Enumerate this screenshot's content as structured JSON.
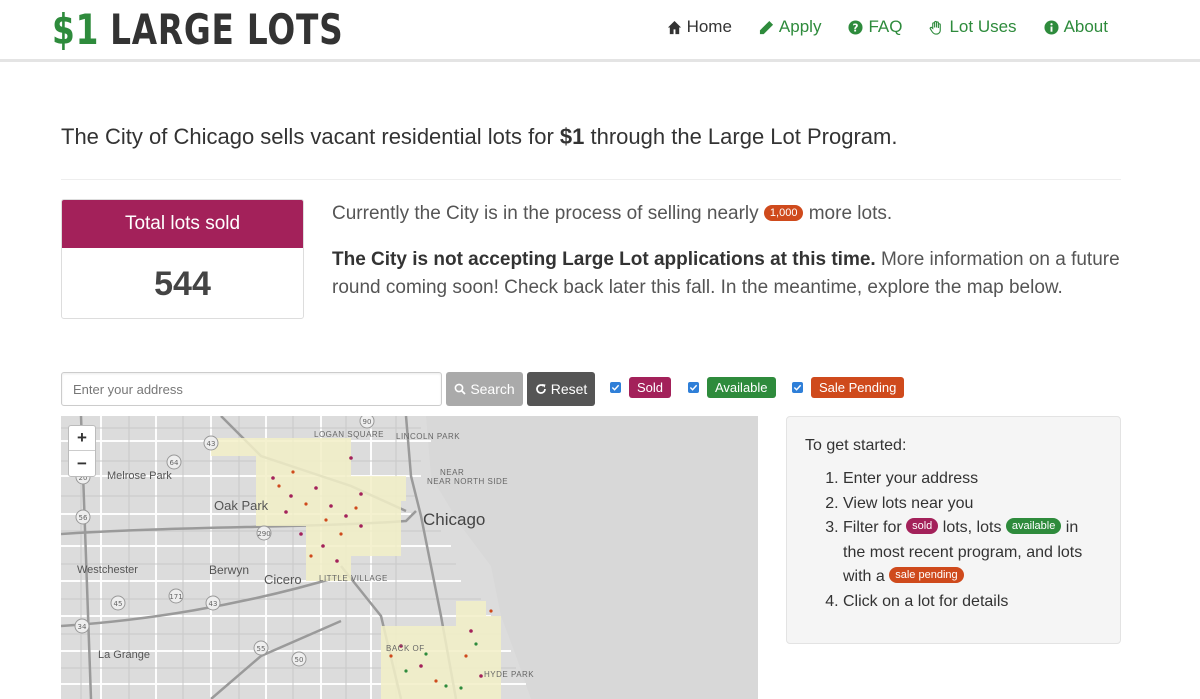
{
  "brand": {
    "dollar": "$1",
    "name": "LARGE LOTS"
  },
  "nav": [
    {
      "label": "Home",
      "icon": "home-icon"
    },
    {
      "label": "Apply",
      "icon": "pencil-icon"
    },
    {
      "label": "FAQ",
      "icon": "question-circle-icon"
    },
    {
      "label": "Lot Uses",
      "icon": "hand-icon"
    },
    {
      "label": "About",
      "icon": "info-circle-icon"
    }
  ],
  "intro": {
    "before": "The City of Chicago sells vacant residential lots for ",
    "bold": "$1",
    "after": " through the Large Lot Program."
  },
  "stats": {
    "label": "Total lots sold",
    "value": "544"
  },
  "status": {
    "line1_before": "Currently the City is in the process of selling nearly ",
    "line1_badge": "1,000",
    "line1_after": " more lots.",
    "line2_bold": "The City is not accepting Large Lot applications at this time.",
    "line2_rest": " More information on a future round coming soon! Check back later this fall. In the meantime, explore the map below."
  },
  "search": {
    "placeholder": "Enter your address",
    "search_label": "Search",
    "reset_label": "Reset"
  },
  "filters": [
    {
      "label": "Sold",
      "checked": true,
      "color": "#a3215a"
    },
    {
      "label": "Available",
      "checked": true,
      "color": "#2e8b3c"
    },
    {
      "label": "Sale Pending",
      "checked": true,
      "color": "#cf4a1c"
    }
  ],
  "map": {
    "zoom_in": "+",
    "zoom_out": "−",
    "labels": {
      "melrose_park": "Melrose Park",
      "oak_park": "Oak Park",
      "chicago": "Chicago",
      "westchester": "Westchester",
      "berwyn": "Berwyn",
      "cicero": "Cicero",
      "la_grange": "La Grange",
      "logan_square": "LOGAN SQUARE",
      "lincoln_park": "LINCOLN PARK",
      "near_north_side": "NEAR NORTH SIDE",
      "near": "NEAR",
      "little_village": "LITTLE VILLAGE",
      "back_of": "BACK OF",
      "hyde_park": "HYDE PARK"
    },
    "shields": [
      "43",
      "64",
      "20",
      "56",
      "290",
      "171",
      "45",
      "34",
      "55",
      "50",
      "43",
      "90"
    ]
  },
  "help": {
    "title": "To get started:",
    "step1": "Enter your address",
    "step2": "View lots near you",
    "step3_a": "Filter for ",
    "step3_sold": "sold",
    "step3_b": " lots, lots ",
    "step3_available": "available",
    "step3_c": " in the most recent program, and lots with a ",
    "step3_pending": "sale pending",
    "step4": "Click on a lot for details"
  },
  "colors": {
    "brand_green": "#2e8b3c",
    "sold": "#a3215a",
    "pending": "#cf4a1c"
  }
}
